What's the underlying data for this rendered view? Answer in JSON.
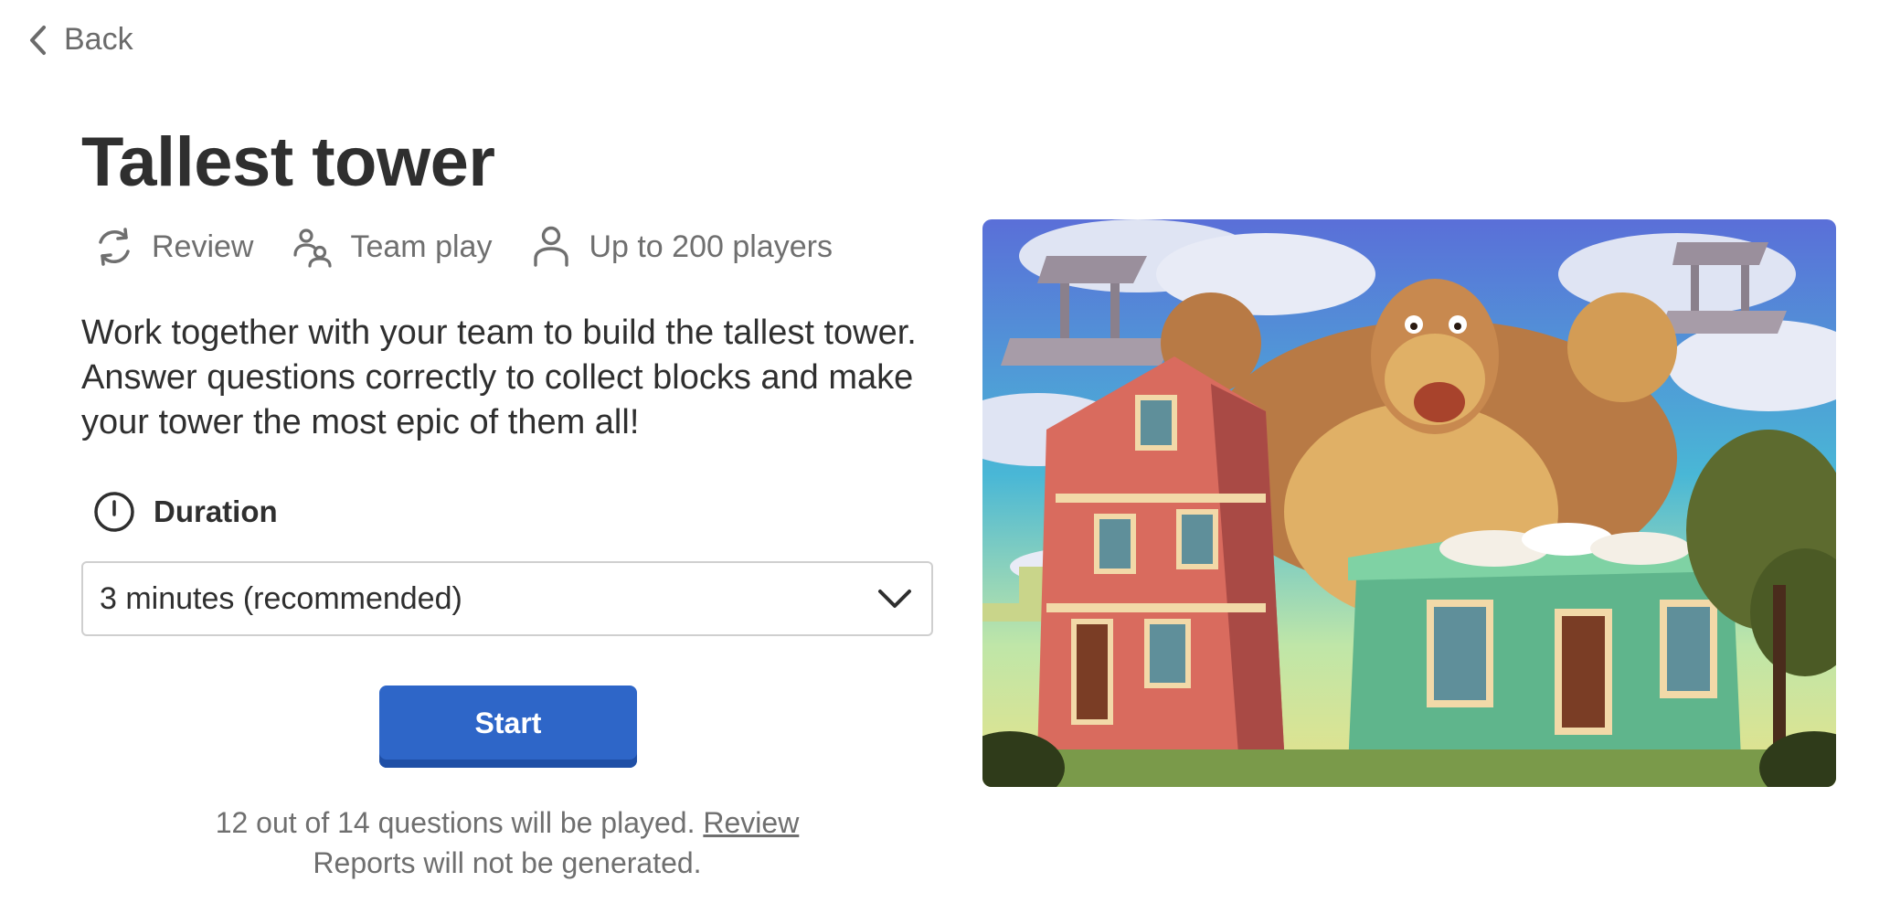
{
  "nav": {
    "back_label": "Back"
  },
  "game": {
    "title": "Tallest tower",
    "tags": [
      {
        "icon": "refresh-icon",
        "label": "Review"
      },
      {
        "icon": "team-icon",
        "label": "Team play"
      },
      {
        "icon": "person-icon",
        "label": "Up to 200 players"
      }
    ],
    "description": "Work together with your team to build the tallest tower. Answer questions correctly to collect blocks and make your tower the most epic of them all!"
  },
  "duration": {
    "label": "Duration",
    "icon": "clock-icon",
    "selected": "3 minutes (recommended)"
  },
  "start_label": "Start",
  "notes": {
    "questions_text": "12 out of 14 questions will be played.",
    "review_link": "Review",
    "reports_text": "Reports will not be generated."
  },
  "colors": {
    "primary": "#2e66c8",
    "primary_shadow": "#1f4fa6",
    "text_dark": "#2f2f2f",
    "text_muted": "#6f6f6f"
  }
}
